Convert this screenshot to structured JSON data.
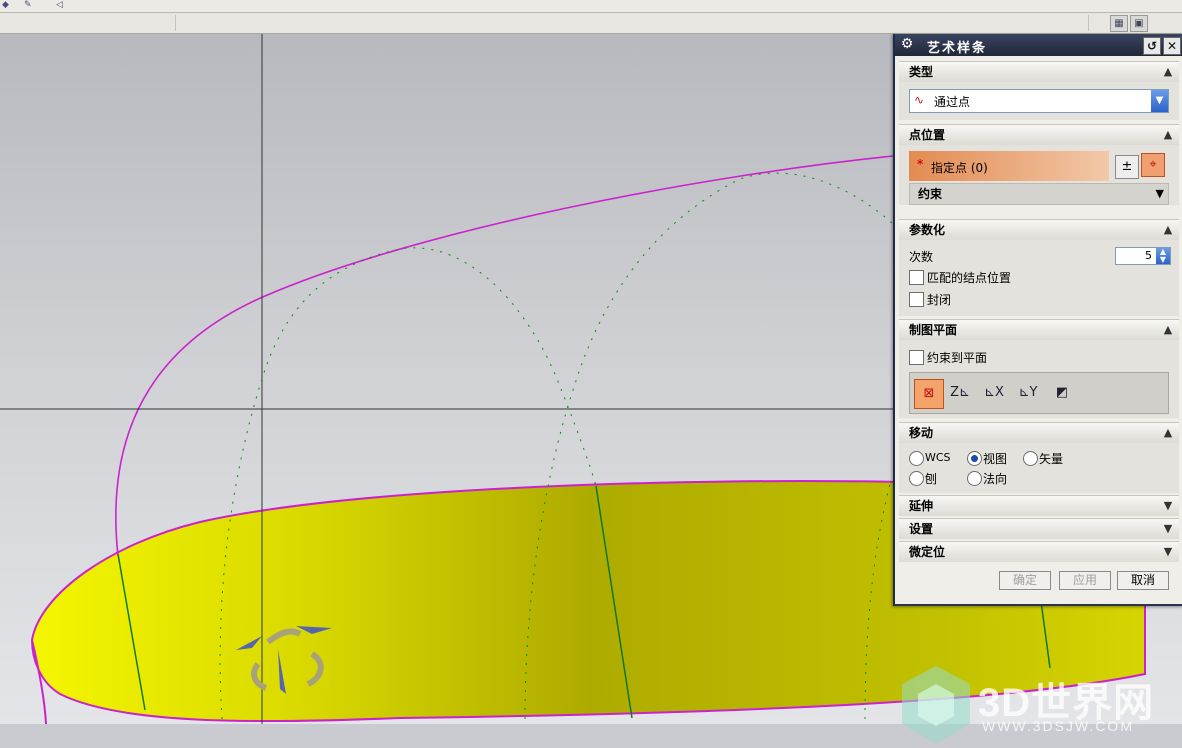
{
  "dialog": {
    "title": "艺术样条",
    "sections": {
      "type": {
        "header": "类型",
        "combo_value": "通过点"
      },
      "point_position": {
        "header": "点位置",
        "specify_point": "指定点 (0)",
        "constraint_header": "约束"
      },
      "parameterization": {
        "header": "参数化",
        "degree_label": "次数",
        "degree_value": "5",
        "match_knot_label": "匹配的结点位置",
        "closed_label": "封闭"
      },
      "drawing_plane": {
        "header": "制图平面",
        "constrain_label": "约束到平面"
      },
      "move": {
        "header": "移动",
        "options": [
          "WCS",
          "视图",
          "矢量",
          "刨",
          "法向"
        ],
        "selected": "视图"
      },
      "extend": {
        "header": "延伸"
      },
      "settings": {
        "header": "设置"
      },
      "fine_positioning": {
        "header": "微定位"
      }
    },
    "footer": {
      "ok": "确定",
      "apply": "应用",
      "cancel": "取消"
    }
  },
  "watermark": {
    "title": "3D世界网",
    "url": "WWW.3DSJW.COM"
  },
  "colors": {
    "surface_yellow": "#e9ec00",
    "curve_magenta": "#cc22cc",
    "point_green": "#0a8a0a",
    "title_bar": "#222a3e",
    "highlight_orange": "#e38b52"
  },
  "icons": {
    "gear": "gear-icon",
    "reset": "reset-icon",
    "close": "close-icon",
    "spline_type": "spline-icon",
    "point_dialog": "point-dialog-icon",
    "point_constructor": "crosshair-icon",
    "view_plane": "view-plane-icon",
    "xc_yc_plane": "zc-plane-icon",
    "yc_zc_plane": "xc-plane-icon",
    "xc_zc_plane": "yc-plane-icon",
    "custom_plane": "custom-plane-icon"
  }
}
